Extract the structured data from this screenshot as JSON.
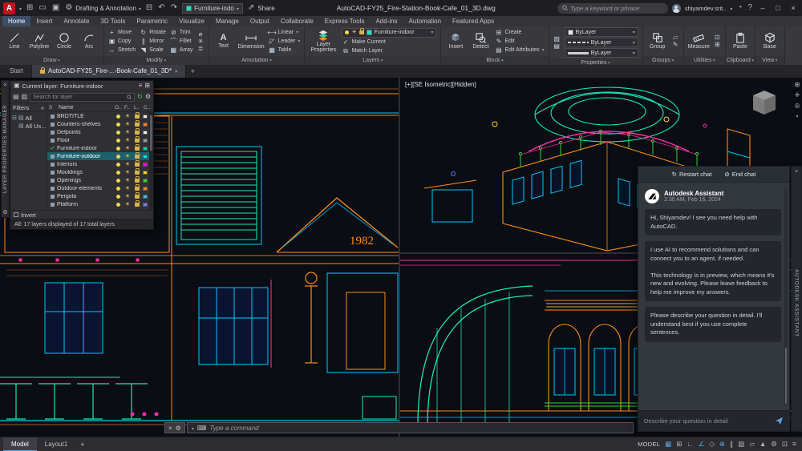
{
  "titlebar": {
    "logo": "A",
    "workspace": "Drafting & Annotation",
    "qat_layer": "Furniture-indo",
    "share": "Share",
    "doc_title": "AutoCAD-FY25_Fire-Station-Book-Cafe_01_3D.dwg",
    "search_placeholder": "Type a keyword or phrase",
    "user": "shiyamdev.srit.."
  },
  "ribbon_tabs": [
    {
      "label": "Home",
      "active": true
    },
    {
      "label": "Insert"
    },
    {
      "label": "Annotate"
    },
    {
      "label": "3D Tools"
    },
    {
      "label": "Parametric"
    },
    {
      "label": "Visualize"
    },
    {
      "label": "Manage"
    },
    {
      "label": "Output"
    },
    {
      "label": "Collaborate"
    },
    {
      "label": "Express Tools"
    },
    {
      "label": "Add-ins"
    },
    {
      "label": "Automation"
    },
    {
      "label": "Featured Apps"
    }
  ],
  "ribbon": {
    "draw": {
      "title": "Draw",
      "line": "Line",
      "polyline": "Polyline",
      "circle": "Circle",
      "arc": "Arc"
    },
    "modify": {
      "title": "Modify",
      "move": "Move",
      "rotate": "Rotate",
      "trim": "Trim",
      "copy": "Copy",
      "mirror": "Mirror",
      "fillet": "Fillet",
      "stretch": "Stretch",
      "scale": "Scale",
      "array": "Array"
    },
    "annotation": {
      "title": "Annotation",
      "text": "Text",
      "dimension": "Dimension",
      "linear": "Linear",
      "leader": "Leader",
      "table": "Table"
    },
    "layers": {
      "title": "Layers",
      "layer_properties": "Layer Properties",
      "current_layer": "Furniture-indoor",
      "make_current": "Make Current",
      "match_layer": "Match Layer"
    },
    "block": {
      "title": "Block",
      "insert": "Insert",
      "detect": "Detect",
      "create": "Create",
      "edit": "Edit",
      "edit_attributes": "Edit Attributes"
    },
    "properties": {
      "title": "Properties",
      "color": "ByLayer",
      "linetype": "ByLayer",
      "lineweight": "ByLayer"
    },
    "groups": {
      "title": "Groups",
      "group": "Group"
    },
    "utilities": {
      "title": "Utilities",
      "measure": "Measure"
    },
    "clipboard": {
      "title": "Clipboard",
      "paste": "Paste"
    },
    "view": {
      "title": "View",
      "base": "Base"
    }
  },
  "file_tabs": {
    "start": "Start",
    "doc": "AutoCAD-FY25_Fire-...-Book-Cafe_01_3D*"
  },
  "layer_manager": {
    "side_title": "LAYER PROPERTIES MANAGER",
    "current_layer": "Current layer: Furniture-indoor",
    "search_placeholder": "Search for layer",
    "filters_title": "Filters",
    "tree": {
      "root": "All",
      "child": "All Us..."
    },
    "columns": {
      "status": "S",
      "name": "Name",
      "on": "O..",
      "freeze": "F..",
      "lock": "L..",
      "color": "C.."
    },
    "layers": [
      {
        "name": "BRDTITLE",
        "color": "#f0f0f0"
      },
      {
        "name": "Counters-shelves",
        "color": "#ff7f2a"
      },
      {
        "name": "Defpoints",
        "color": "#f0f0f0"
      },
      {
        "name": "Floor",
        "color": "#9d9d9d"
      },
      {
        "name": "Furniture-indoor",
        "color": "#00d7a8",
        "current": true
      },
      {
        "name": "Furniture-outdoor",
        "color": "#00e5ff",
        "selected": true
      },
      {
        "name": "Interiors",
        "color": "#ff00ff"
      },
      {
        "name": "Mouldings",
        "color": "#ffd700"
      },
      {
        "name": "Openings",
        "color": "#35d435"
      },
      {
        "name": "Outdoor-elements",
        "color": "#ff7f2a"
      },
      {
        "name": "Pergola",
        "color": "#35c4e8"
      },
      {
        "name": "Platform",
        "color": "#7a7aff"
      }
    ],
    "invert_label": "Invert",
    "status": "All: 17 layers displayed of 17 total layers"
  },
  "viewports": {
    "iso_label": "[+][SE Isometric][Hidden]",
    "facade_year": "1982"
  },
  "command_line": {
    "placeholder": "Type a command"
  },
  "assistant": {
    "restart": "Restart chat",
    "end": "End chat",
    "name": "Autodesk Assistant",
    "timestamp": "2:30 AM, Feb 16, 2024",
    "messages": [
      {
        "text": "Hi, Shiyamdev! I see you need help with AutoCAD."
      },
      {
        "text": "I use AI to recommend solutions and can connect you to an agent, if needed.\n\nThis technology is in preview, which means it's new and evolving. Please leave feedback to help me improve my answers."
      },
      {
        "text": "Please describe your question in detail. I'll understand best if you use complete sentences."
      }
    ],
    "input_placeholder": "Describe your question in detail",
    "side_title": "AUTODESK ASSISTANT"
  },
  "bottom": {
    "model_tab": "Model",
    "layout_tab": "Layout1",
    "mode_label": "MODEL"
  },
  "colors": {
    "cad_cyan": "#00c8ff",
    "cad_orange": "#ff8c1a",
    "cad_magenta": "#ff2ea6",
    "cad_teal": "#1de9b6",
    "accent_blue": "#5aa7e8"
  }
}
